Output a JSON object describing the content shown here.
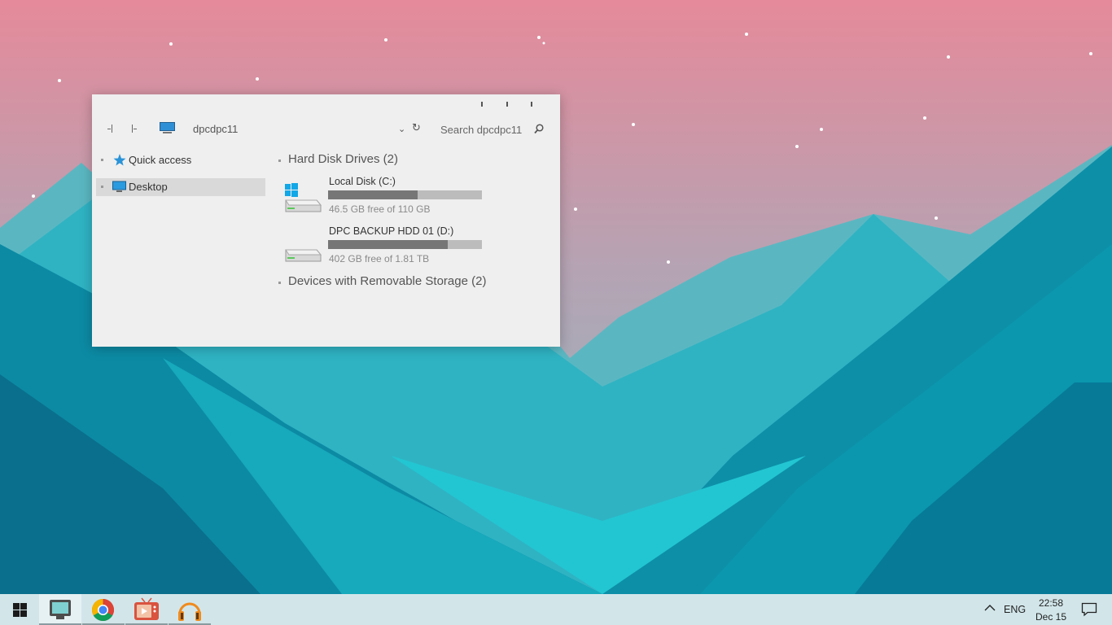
{
  "window": {
    "address": "dpcdpc11",
    "search_placeholder": "Search dpcdpc11"
  },
  "nav_pane": {
    "items": [
      {
        "label": "Quick access",
        "icon": "star-icon",
        "selected": false
      },
      {
        "label": "Desktop",
        "icon": "desktop-icon",
        "selected": true
      }
    ]
  },
  "content": {
    "groups": [
      {
        "label": "Hard Disk Drives (2)"
      },
      {
        "label": "Devices with Removable Storage (2)"
      }
    ],
    "drives": [
      {
        "name": "Local Disk (C:)",
        "free_text": "46.5 GB free of 110 GB",
        "used_fraction": 0.58,
        "icon": "windows-drive-icon"
      },
      {
        "name": "DPC BACKUP HDD 01 (D:)",
        "free_text": "402 GB free of 1.81 TB",
        "used_fraction": 0.78,
        "icon": "hard-drive-icon"
      }
    ]
  },
  "taskbar": {
    "apps": [
      {
        "name": "file-explorer-icon",
        "active": true
      },
      {
        "name": "chrome-icon",
        "active": false
      },
      {
        "name": "media-player-icon",
        "active": false
      },
      {
        "name": "headphones-icon",
        "active": false
      }
    ],
    "language": "ENG",
    "time": "22:58",
    "date": "Dec 15"
  },
  "colors": {
    "sky_top": "#e58a9a",
    "sky_bottom": "#8fb8c0",
    "mountain_dark": "#0a7f98",
    "mountain_light": "#25c7d1",
    "taskbar": "#d2e6ea"
  }
}
